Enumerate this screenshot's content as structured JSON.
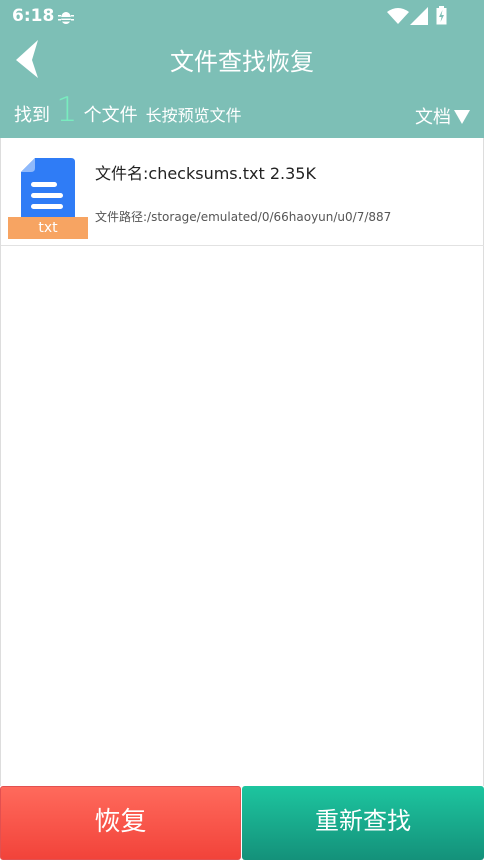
{
  "statusbar": {
    "time": "6:18"
  },
  "header": {
    "title": "文件查找恢复",
    "found_label": "找到",
    "found_count": "1",
    "file_unit": "个文件",
    "hint": "长按预览文件",
    "filter_label": "文档"
  },
  "files": [
    {
      "extension": "txt",
      "name": "文件名:checksums.txt 2.35K",
      "path": "文件路径:/storage/emulated/0/66haoyun/u0/7/887"
    }
  ],
  "actions": {
    "recover_label": "恢复",
    "rescan_label": "重新查找"
  },
  "colors": {
    "header": "#7dbfb6",
    "count": "#79ecbf",
    "recover": "#f2433a",
    "rescan": "#14917a",
    "doc_icon": "#2f7cf6",
    "badge": "#f7a462"
  }
}
